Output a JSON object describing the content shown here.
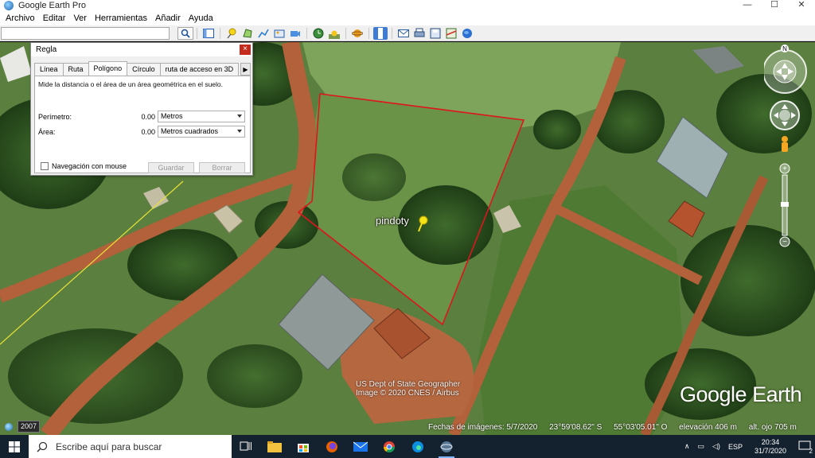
{
  "window": {
    "title": "Google Earth Pro"
  },
  "menu": [
    "Archivo",
    "Editar",
    "Ver",
    "Herramientas",
    "Añadir",
    "Ayuda"
  ],
  "search": {
    "value": ""
  },
  "ruler": {
    "title": "Regla",
    "close": "×",
    "tabs": [
      "Línea",
      "Ruta",
      "Polígono",
      "Círculo",
      "ruta de acceso en 3D"
    ],
    "selected_tab": "Polígono",
    "description": "Mide la distancia o el área de un área geométrica en el suelo.",
    "perimeter": {
      "label": "Perímetro:",
      "value": "0.00",
      "unit": "Metros"
    },
    "area": {
      "label": "Área:",
      "value": "0.00",
      "unit": "Metros cuadrados"
    },
    "mouse_nav": "Navegación con mouse",
    "save": "Guardar",
    "clear": "Borrar"
  },
  "map": {
    "placemark": "pindoty",
    "attribution_1": "US Dept of State Geographer",
    "attribution_2": "Image © 2020 CNES / Airbus",
    "logo": "Google Earth",
    "year": "2007",
    "imagery_date": "Fechas de imágenes: 5/7/2020",
    "lat": "23°59'08.62\" S",
    "lon": "55°03'05.01\" O",
    "elevation": "elevación   406 m",
    "eye_alt": "alt. ojo   705 m",
    "compass_n": "N"
  },
  "taskbar": {
    "search_placeholder": "Escribe aquí para buscar",
    "lang": "ESP",
    "time": "20:34",
    "date": "31/7/2020",
    "notifications": "2"
  },
  "colors": {
    "polygon": "#e0141e",
    "accent": "#3d7bd6"
  }
}
